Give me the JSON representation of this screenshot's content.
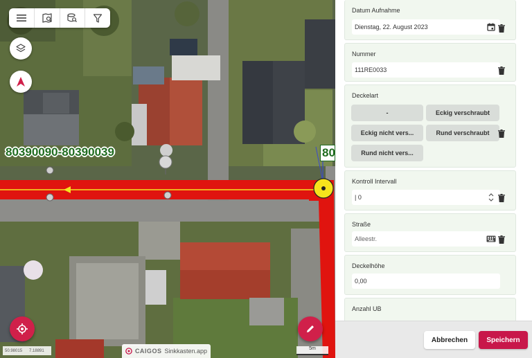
{
  "map": {
    "label_pipe": "80390090-80390039",
    "label_cut": "80",
    "brand_logo": "CAIGOS",
    "brand_app": "Sinkkasten.app",
    "scale_left_a": "50.98015",
    "scale_left_b": "7.18891",
    "scale_right": "5m",
    "colors": {
      "pipe": "#e0140f",
      "marker": "#f6e31c",
      "label": "#1f6b1f",
      "fab": "#d0204a"
    },
    "toolbar_icons": [
      "menu-icon",
      "map-search-icon",
      "database-search-icon",
      "filter-icon"
    ]
  },
  "form": {
    "datum": {
      "label": "Datum Aufnahme",
      "value": "Dienstag, 22. August 2023"
    },
    "nummer": {
      "label": "Nummer",
      "value": "111RE0033"
    },
    "deckelart": {
      "label": "Deckelart",
      "options": [
        "-",
        "Eckig verschraubt",
        "Eckig nicht vers...",
        "Rund verschraubt",
        "Rund nicht vers..."
      ]
    },
    "kontroll": {
      "label": "Kontroll Intervall",
      "value": "| 0"
    },
    "strasse": {
      "label": "Straße",
      "placeholder": "Alleestr."
    },
    "deckelhoehe": {
      "label": "Deckelhöhe",
      "value": "0,00"
    },
    "anzahl_ub": {
      "label": "Anzahl UB"
    }
  },
  "footer": {
    "cancel": "Abbrechen",
    "save": "Speichern"
  },
  "colors": {
    "accent": "#c8174a",
    "section_bg": "#f1f7ef"
  }
}
